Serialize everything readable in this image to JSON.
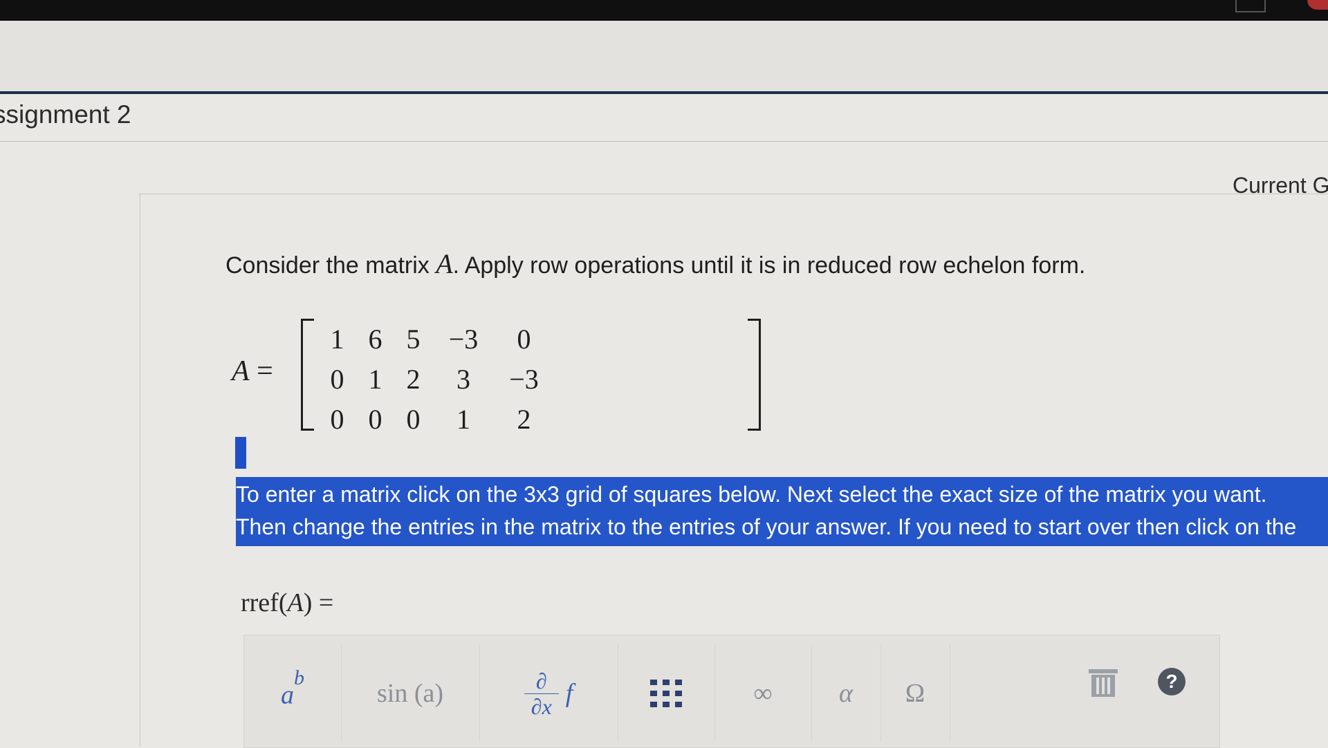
{
  "header": {
    "assignment_title": "ssignment 2",
    "current_grade_label": "Current G"
  },
  "question": {
    "text_before": "Consider the matrix ",
    "matrix_var": "A",
    "text_after": ". Apply row operations until it is in reduced row echelon form."
  },
  "matrix": {
    "lhs": "A",
    "equals": " =",
    "rows": [
      [
        "1",
        "6",
        "5",
        "−3",
        "0"
      ],
      [
        "0",
        "1",
        "2",
        "3",
        "−3"
      ],
      [
        "0",
        "0",
        "0",
        "1",
        "2"
      ]
    ]
  },
  "instructions": {
    "line1": "To enter a matrix click on the 3x3 grid of squares below. Next select the exact size of the matrix you want.",
    "line2": "Then change the entries in the matrix to the entries of your answer. If you need to start over then click on the"
  },
  "answer": {
    "label_prefix": "rref(",
    "label_var": "A",
    "label_suffix": ") ="
  },
  "toolbar": {
    "power_base": "a",
    "power_exp": "b",
    "trig": "sin (a)",
    "deriv_num": "∂",
    "deriv_den": "∂x",
    "deriv_fn": "f",
    "infinity": "∞",
    "alpha": "α",
    "omega": "Ω",
    "help": "?"
  },
  "colors": {
    "highlight": "#2455c9",
    "toolbar_accent": "#3b62b5"
  }
}
